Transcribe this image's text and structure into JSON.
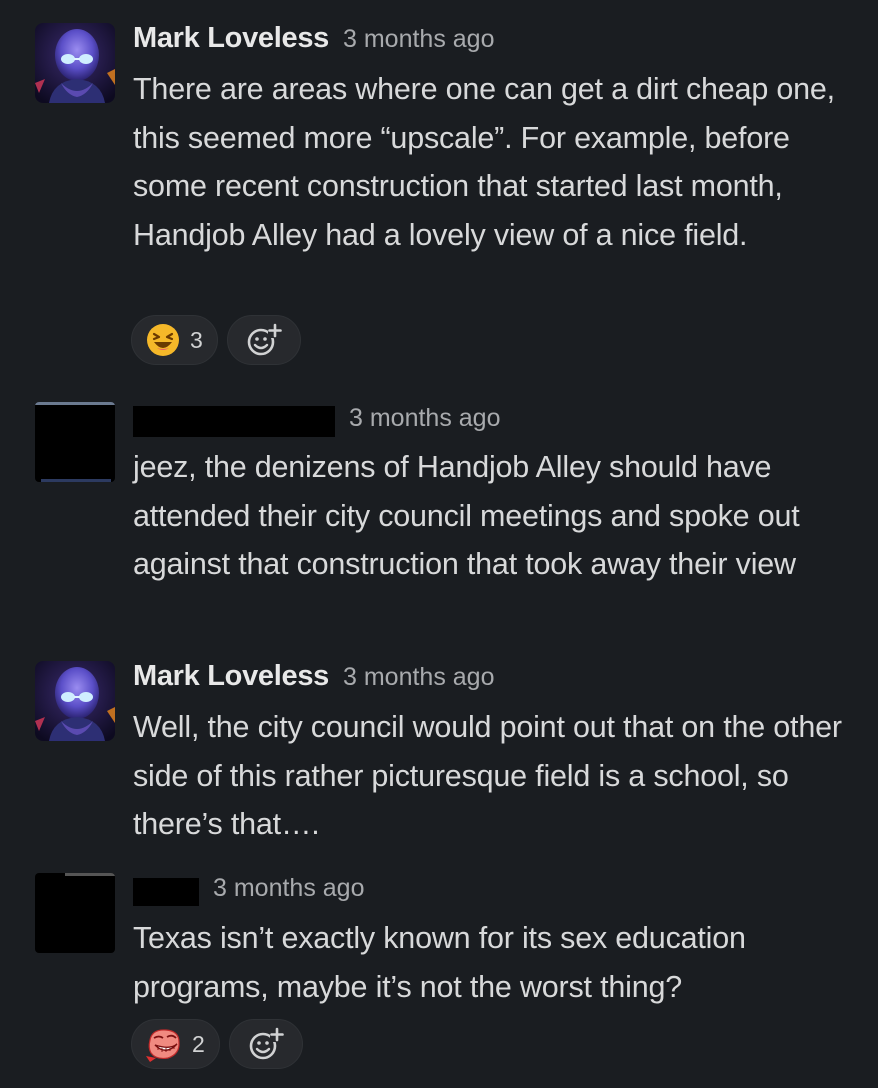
{
  "messages": [
    {
      "author": "Mark Loveless",
      "time": "3 months ago",
      "text": "There are areas where one can get a dirt cheap one, this seemed more “upscale”. For example, before some recent construction that started last month, Handjob Alley had a lovely view of a nice field.",
      "avatar_icon": "profile-photo",
      "reactions": [
        {
          "emoji": "laughing-emoji-icon",
          "count": "3"
        }
      ],
      "add_reaction_icon": "add-reaction-icon"
    },
    {
      "author": "",
      "time": "3 months ago",
      "text": "jeez, the denizens of Handjob Alley should have attended their city council meetings and spoke out against that construction that took away their view",
      "avatar_icon": "redacted-avatar"
    },
    {
      "author": "Mark Loveless",
      "time": "3 months ago",
      "text": "Well, the city council would point out that on the other side of this rather picturesque field is a school, so there’s that….",
      "avatar_icon": "profile-photo"
    },
    {
      "author": "",
      "time": "3 months ago",
      "text": "Texas isn’t exactly known for its sex education programs, maybe it’s not the worst thing?",
      "avatar_icon": "redacted-avatar",
      "reactions": [
        {
          "emoji": "trollface-emoji-icon",
          "count": "2"
        }
      ],
      "add_reaction_icon": "add-reaction-icon"
    }
  ],
  "colors": {
    "background": "#1a1d21",
    "text": "#d8d9da",
    "timestamp": "#a8aaad",
    "pill": "#27292d"
  }
}
